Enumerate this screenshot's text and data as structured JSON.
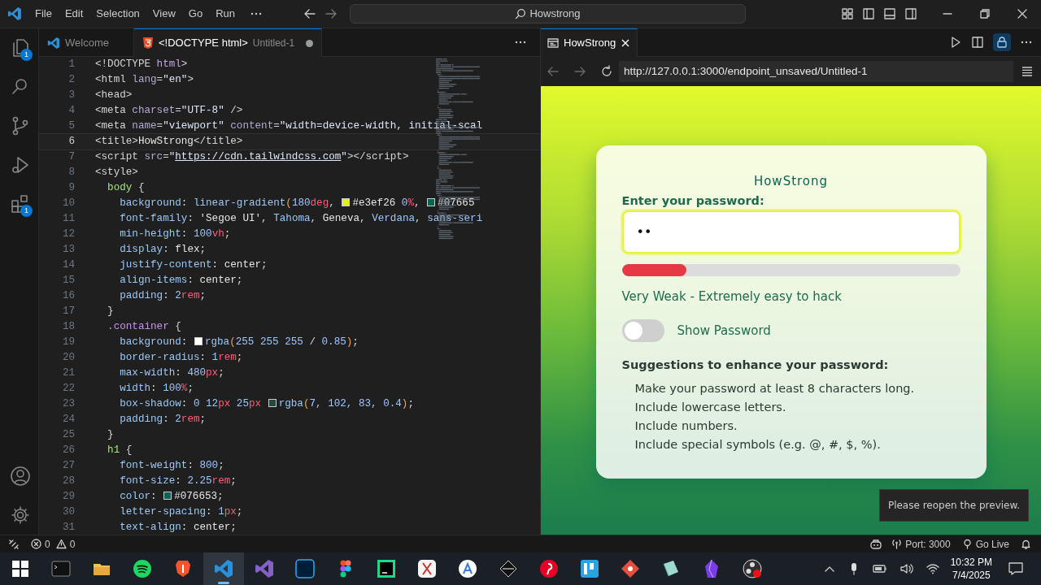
{
  "title_bar": {
    "menu": [
      "File",
      "Edit",
      "Selection",
      "View",
      "Go",
      "Run"
    ],
    "search": "Howstrong"
  },
  "activity_bar": {
    "items": [
      {
        "badge": "1",
        "selected": false
      },
      {
        "selected": false
      },
      {
        "selected": false
      },
      {
        "selected": false
      },
      {
        "badge": "1",
        "selected": false
      }
    ]
  },
  "editor": {
    "tabs": [
      {
        "label": "Welcome",
        "modified": false,
        "selected": false
      },
      {
        "label": "<!DOCTYPE html>",
        "description": "Untitled-1",
        "modified": true,
        "selected": true
      }
    ],
    "lines": [
      {
        "num": "1",
        "current": false,
        "tokens": [
          {
            "kind": "p",
            "text": "<!DOCTYPE"
          },
          {
            "kind": "kw",
            "text": " html"
          },
          {
            "kind": "p",
            "text": ">"
          }
        ]
      },
      {
        "num": "2",
        "current": false,
        "tokens": [
          {
            "kind": "p",
            "text": "<html"
          },
          {
            "kind": "attr",
            "text": " lang"
          },
          {
            "kind": "p",
            "text": "="
          },
          {
            "kind": "str",
            "text": "\"en\""
          },
          {
            "kind": "p",
            "text": ">"
          }
        ]
      },
      {
        "num": "3",
        "current": false,
        "tokens": [
          {
            "kind": "p",
            "text": "<head>"
          }
        ]
      },
      {
        "num": "4",
        "current": false,
        "tokens": [
          {
            "kind": "p",
            "text": "<meta"
          },
          {
            "kind": "attr",
            "text": " charset"
          },
          {
            "kind": "p",
            "text": "="
          },
          {
            "kind": "str",
            "text": "\"UTF-8\""
          },
          {
            "kind": "p",
            "text": " />"
          }
        ]
      },
      {
        "num": "5",
        "current": false,
        "tokens": [
          {
            "kind": "p",
            "text": "<meta"
          },
          {
            "kind": "attr",
            "text": " name"
          },
          {
            "kind": "p",
            "text": "="
          },
          {
            "kind": "str",
            "text": "\"viewport\""
          },
          {
            "kind": "attr",
            "text": " content"
          },
          {
            "kind": "p",
            "text": "="
          },
          {
            "kind": "str",
            "text": "\"width=device-width, initial-scal"
          }
        ]
      },
      {
        "num": "6",
        "current": true,
        "tokens": [
          {
            "kind": "p",
            "text": "<title>"
          },
          {
            "kind": "val",
            "text": "HowStrong"
          },
          {
            "kind": "p",
            "text": "</title>"
          }
        ]
      },
      {
        "num": "7",
        "current": false,
        "tokens": [
          {
            "kind": "p",
            "text": "<script"
          },
          {
            "kind": "attr",
            "text": " src"
          },
          {
            "kind": "p",
            "text": "="
          },
          {
            "kind": "str",
            "text": "\""
          },
          {
            "kind": "url",
            "text": "https://cdn.tailwindcss.com"
          },
          {
            "kind": "str",
            "text": "\""
          },
          {
            "kind": "p",
            "text": "></script>"
          }
        ]
      },
      {
        "num": "8",
        "current": false,
        "tokens": [
          {
            "kind": "p",
            "text": "<style>"
          }
        ]
      },
      {
        "num": "9",
        "current": false,
        "tokens": [
          {
            "kind": "sel",
            "text": "  body"
          },
          {
            "kind": "p",
            "text": " {"
          }
        ]
      },
      {
        "num": "10",
        "current": false,
        "tokens": [
          {
            "kind": "prop",
            "text": "    background"
          },
          {
            "kind": "p",
            "text": ": "
          },
          {
            "kind": "fn",
            "text": "linear-gradient"
          },
          {
            "kind": "br",
            "text": "("
          },
          {
            "kind": "num",
            "text": "180"
          },
          {
            "kind": "unit",
            "text": "deg"
          },
          {
            "kind": "p",
            "text": ", "
          },
          {
            "kind": "swatch",
            "color": "#e3ef26"
          },
          {
            "kind": "val",
            "text": "#e3ef26 "
          },
          {
            "kind": "num",
            "text": "0"
          },
          {
            "kind": "unit",
            "text": "%"
          },
          {
            "kind": "p",
            "text": ", "
          },
          {
            "kind": "swatch",
            "color": "#076653"
          },
          {
            "kind": "val",
            "text": "#07665"
          }
        ]
      },
      {
        "num": "11",
        "current": false,
        "tokens": [
          {
            "kind": "prop",
            "text": "    font-family"
          },
          {
            "kind": "p",
            "text": ": "
          },
          {
            "kind": "val",
            "text": "'Segoe UI'"
          },
          {
            "kind": "p",
            "text": ", "
          },
          {
            "kind": "fn",
            "text": "Tahoma"
          },
          {
            "kind": "p",
            "text": ", "
          },
          {
            "kind": "val",
            "text": "Geneva"
          },
          {
            "kind": "p",
            "text": ", "
          },
          {
            "kind": "fn",
            "text": "Verdana"
          },
          {
            "kind": "p",
            "text": ", "
          },
          {
            "kind": "fn",
            "text": "sans-seri"
          }
        ]
      },
      {
        "num": "12",
        "current": false,
        "tokens": [
          {
            "kind": "prop",
            "text": "    min-height"
          },
          {
            "kind": "p",
            "text": ": "
          },
          {
            "kind": "num",
            "text": "100"
          },
          {
            "kind": "unit",
            "text": "vh"
          },
          {
            "kind": "p",
            "text": ";"
          }
        ]
      },
      {
        "num": "13",
        "current": false,
        "tokens": [
          {
            "kind": "prop",
            "text": "    display"
          },
          {
            "kind": "p",
            "text": ": "
          },
          {
            "kind": "val",
            "text": "flex"
          },
          {
            "kind": "p",
            "text": ";"
          }
        ]
      },
      {
        "num": "14",
        "current": false,
        "tokens": [
          {
            "kind": "prop",
            "text": "    justify-content"
          },
          {
            "kind": "p",
            "text": ": "
          },
          {
            "kind": "val",
            "text": "center"
          },
          {
            "kind": "p",
            "text": ";"
          }
        ]
      },
      {
        "num": "15",
        "current": false,
        "tokens": [
          {
            "kind": "prop",
            "text": "    align-items"
          },
          {
            "kind": "p",
            "text": ": "
          },
          {
            "kind": "val",
            "text": "center"
          },
          {
            "kind": "p",
            "text": ";"
          }
        ]
      },
      {
        "num": "16",
        "current": false,
        "tokens": [
          {
            "kind": "prop",
            "text": "    padding"
          },
          {
            "kind": "p",
            "text": ": "
          },
          {
            "kind": "num",
            "text": "2"
          },
          {
            "kind": "unit",
            "text": "rem"
          },
          {
            "kind": "p",
            "text": ";"
          }
        ]
      },
      {
        "num": "17",
        "current": false,
        "tokens": [
          {
            "kind": "p",
            "text": "  }"
          }
        ]
      },
      {
        "num": "18",
        "current": false,
        "tokens": [
          {
            "kind": "cls",
            "text": "  .container"
          },
          {
            "kind": "p",
            "text": " {"
          }
        ]
      },
      {
        "num": "19",
        "current": false,
        "tokens": [
          {
            "kind": "prop",
            "text": "    background"
          },
          {
            "kind": "p",
            "text": ": "
          },
          {
            "kind": "swatch",
            "color": "#ffffff"
          },
          {
            "kind": "fn",
            "text": "rgba"
          },
          {
            "kind": "br",
            "text": "("
          },
          {
            "kind": "num",
            "text": "255 255 255"
          },
          {
            "kind": "p",
            "text": " / "
          },
          {
            "kind": "num",
            "text": "0.85"
          },
          {
            "kind": "br",
            "text": ")"
          },
          {
            "kind": "p",
            "text": ";"
          }
        ]
      },
      {
        "num": "20",
        "current": false,
        "tokens": [
          {
            "kind": "prop",
            "text": "    border-radius"
          },
          {
            "kind": "p",
            "text": ": "
          },
          {
            "kind": "num",
            "text": "1"
          },
          {
            "kind": "unit",
            "text": "rem"
          },
          {
            "kind": "p",
            "text": ";"
          }
        ]
      },
      {
        "num": "21",
        "current": false,
        "tokens": [
          {
            "kind": "prop",
            "text": "    max-width"
          },
          {
            "kind": "p",
            "text": ": "
          },
          {
            "kind": "num",
            "text": "480"
          },
          {
            "kind": "unit",
            "text": "px"
          },
          {
            "kind": "p",
            "text": ";"
          }
        ]
      },
      {
        "num": "22",
        "current": false,
        "tokens": [
          {
            "kind": "prop",
            "text": "    width"
          },
          {
            "kind": "p",
            "text": ": "
          },
          {
            "kind": "num",
            "text": "100"
          },
          {
            "kind": "unit",
            "text": "%"
          },
          {
            "kind": "p",
            "text": ";"
          }
        ]
      },
      {
        "num": "23",
        "current": false,
        "tokens": [
          {
            "kind": "prop",
            "text": "    box-shadow"
          },
          {
            "kind": "p",
            "text": ": "
          },
          {
            "kind": "num",
            "text": "0 12"
          },
          {
            "kind": "unit",
            "text": "px"
          },
          {
            "kind": "num",
            "text": " 25"
          },
          {
            "kind": "unit",
            "text": "px "
          },
          {
            "kind": "swatch",
            "color": "#27443d"
          },
          {
            "kind": "fn",
            "text": "rgba"
          },
          {
            "kind": "br",
            "text": "("
          },
          {
            "kind": "num",
            "text": "7, 102, 83, 0.4"
          },
          {
            "kind": "br",
            "text": ")"
          },
          {
            "kind": "p",
            "text": ";"
          }
        ]
      },
      {
        "num": "24",
        "current": false,
        "tokens": [
          {
            "kind": "prop",
            "text": "    padding"
          },
          {
            "kind": "p",
            "text": ": "
          },
          {
            "kind": "num",
            "text": "2"
          },
          {
            "kind": "unit",
            "text": "rem"
          },
          {
            "kind": "p",
            "text": ";"
          }
        ]
      },
      {
        "num": "25",
        "current": false,
        "tokens": [
          {
            "kind": "p",
            "text": "  }"
          }
        ]
      },
      {
        "num": "26",
        "current": false,
        "tokens": [
          {
            "kind": "sel",
            "text": "  h1"
          },
          {
            "kind": "p",
            "text": " {"
          }
        ]
      },
      {
        "num": "27",
        "current": false,
        "tokens": [
          {
            "kind": "prop",
            "text": "    font-weight"
          },
          {
            "kind": "p",
            "text": ": "
          },
          {
            "kind": "num",
            "text": "800"
          },
          {
            "kind": "p",
            "text": ";"
          }
        ]
      },
      {
        "num": "28",
        "current": false,
        "tokens": [
          {
            "kind": "prop",
            "text": "    font-size"
          },
          {
            "kind": "p",
            "text": ": "
          },
          {
            "kind": "num",
            "text": "2.25"
          },
          {
            "kind": "unit",
            "text": "rem"
          },
          {
            "kind": "p",
            "text": ";"
          }
        ]
      },
      {
        "num": "29",
        "current": false,
        "tokens": [
          {
            "kind": "prop",
            "text": "    color"
          },
          {
            "kind": "p",
            "text": ": "
          },
          {
            "kind": "swatch",
            "color": "#076653"
          },
          {
            "kind": "val",
            "text": "#076653"
          },
          {
            "kind": "p",
            "text": ";"
          }
        ]
      },
      {
        "num": "30",
        "current": false,
        "tokens": [
          {
            "kind": "prop",
            "text": "    letter-spacing"
          },
          {
            "kind": "p",
            "text": ": "
          },
          {
            "kind": "num",
            "text": "1"
          },
          {
            "kind": "unit",
            "text": "px"
          },
          {
            "kind": "p",
            "text": ";"
          }
        ]
      },
      {
        "num": "31",
        "current": false,
        "tokens": [
          {
            "kind": "prop",
            "text": "    text-align"
          },
          {
            "kind": "p",
            "text": ": "
          },
          {
            "kind": "val",
            "text": "center"
          },
          {
            "kind": "p",
            "text": ";"
          }
        ]
      }
    ]
  },
  "preview": {
    "tab": {
      "label": "HowStrong",
      "selected": true
    },
    "url": "http://127.0.0.1:3000/endpoint_unsaved/Untitled-1",
    "page": {
      "title": "HowStrong",
      "label": "Enter your password:",
      "password": "••",
      "strength": {
        "level": 0.19
      },
      "strength_text": "Very Weak - Extremely easy to hack",
      "show_password": {
        "label": "Show Password",
        "checked": false
      },
      "suggestions_title": "Suggestions to enhance your password:",
      "suggestions": [
        "Make your password at least 8 characters long.",
        "Include lowercase letters.",
        "Include numbers.",
        "Include special symbols (e.g. @, #, $, %)."
      ]
    },
    "toast": "Please reopen the preview."
  },
  "status_bar": {
    "errors": "0",
    "warnings": "0",
    "port": "Port: 3000",
    "go_live": "Go Live"
  },
  "taskbar": {
    "apps": [
      {
        "selected": false
      },
      {
        "selected": false
      },
      {
        "selected": false
      },
      {
        "selected": false
      },
      {
        "selected": true
      },
      {
        "selected": false
      },
      {
        "selected": false
      },
      {
        "selected": false
      },
      {
        "selected": false
      },
      {
        "selected": false
      },
      {
        "selected": false
      },
      {
        "selected": false
      },
      {
        "selected": false
      },
      {
        "selected": false
      },
      {
        "selected": false
      },
      {
        "selected": false
      },
      {
        "selected": false
      },
      {
        "selected": false
      }
    ],
    "time": "10:32 PM",
    "date": "7/4/2025"
  }
}
